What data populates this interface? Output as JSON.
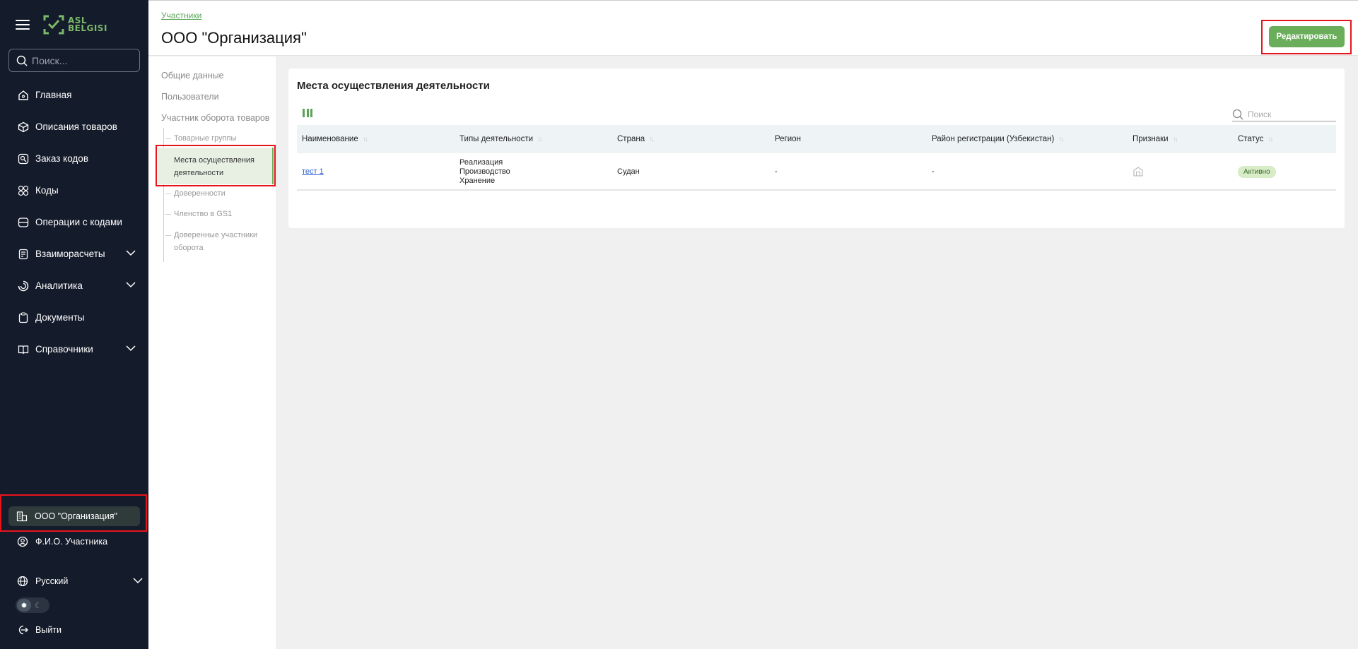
{
  "sidebar": {
    "logo_text_line1": "ASL",
    "logo_text_line2": "BELGISI",
    "search_placeholder": "Поиск...",
    "nav": [
      {
        "label": "Главная",
        "icon": "home-icon"
      },
      {
        "label": "Описания товаров",
        "icon": "box-icon"
      },
      {
        "label": "Заказ кодов",
        "icon": "code-order-icon"
      },
      {
        "label": "Коды",
        "icon": "codes-icon"
      },
      {
        "label": "Операции с кодами",
        "icon": "operations-icon"
      },
      {
        "label": "Взаиморасчеты",
        "icon": "settlements-icon",
        "expandable": true
      },
      {
        "label": "Аналитика",
        "icon": "analytics-icon",
        "expandable": true
      },
      {
        "label": "Документы",
        "icon": "documents-icon"
      },
      {
        "label": "Справочники",
        "icon": "reference-book-icon",
        "expandable": true
      }
    ],
    "org_label": "ООО \"Организация\"",
    "user_label": "Ф.И.О. Участника",
    "language_label": "Русский",
    "logout_label": "Выйти"
  },
  "header": {
    "breadcrumb": "Участники",
    "title": "ООО \"Организация\"",
    "edit_label": "Редактировать"
  },
  "subnav": {
    "general": "Общие данные",
    "users": "Пользователи",
    "participant": "Участник оборота товаров",
    "sub": {
      "product_groups": "Товарные группы",
      "locations": "Места осуществления деятельности",
      "powers_of_attorney": "Доверенности",
      "gs1": "Членство в GS1",
      "trusted": "Доверенные участники оборота"
    }
  },
  "main": {
    "title": "Места осуществления деятельности",
    "search_placeholder": "Поиск",
    "columns": {
      "name": "Наименование",
      "types": "Типы деятельности",
      "country": "Страна",
      "region": "Регион",
      "district": "Район регистрации (Узбекистан)",
      "signs": "Признаки",
      "status": "Статус"
    },
    "rows": [
      {
        "name": "тест 1",
        "types": [
          "Реализация",
          "Производство",
          "Хранение"
        ],
        "country": "Судан",
        "region": "-",
        "district": "-",
        "status": "Активно"
      }
    ]
  },
  "colors": {
    "accent": "#6aad5a",
    "sidebar_bg": "#141b2b",
    "highlight": "#e8141c"
  }
}
